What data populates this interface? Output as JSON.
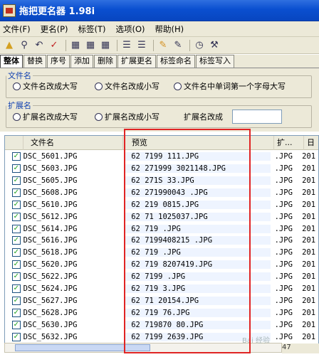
{
  "window": {
    "title": "拖把更名器 1.98i"
  },
  "menu": [
    "文件(F)",
    "更名(P)",
    "标签(T)",
    "选项(O)",
    "帮助(H)"
  ],
  "toolbar_icons": [
    "open-folder-icon",
    "search-icon",
    "undo-icon",
    "check-icon",
    "tag-icon",
    "tag2-icon",
    "tag3-icon",
    "list-icon",
    "list2-icon",
    "edit-icon",
    "edit2-icon",
    "clock-icon",
    "tools-icon"
  ],
  "tabs": [
    "整体",
    "替换",
    "序号",
    "添加",
    "删除",
    "扩展更名",
    "标签命名",
    "标签写入"
  ],
  "filename_group": {
    "legend": "文件名",
    "options": [
      "文件名改成大写",
      "文件名改成小写",
      "文件名中单词第一个字母大写"
    ]
  },
  "ext_group": {
    "legend": "扩展名",
    "options": [
      "扩展名改成大写",
      "扩展名改成小写"
    ],
    "change_label": "扩展名改成",
    "change_value": ""
  },
  "columns": [
    "文件名",
    "预览",
    "扩...",
    "日"
  ],
  "rows": [
    {
      "file": "DSC_5601.JPG",
      "preview": "62   7199    111.JPG",
      "ext": ".JPG",
      "date": "201"
    },
    {
      "file": "DSC_5603.JPG",
      "preview": "62  271999  3021148.JPG",
      "ext": ".JPG",
      "date": "201"
    },
    {
      "file": "DSC_5605.JPG",
      "preview": "62  271S       33.JPG",
      "ext": ".JPG",
      "date": "201"
    },
    {
      "file": "DSC_5608.JPG",
      "preview": "62  271990043      .JPG",
      "ext": ".JPG",
      "date": "201"
    },
    {
      "file": "DSC_5610.JPG",
      "preview": "62  219      0815.JPG",
      "ext": ".JPG",
      "date": "201"
    },
    {
      "file": "DSC_5612.JPG",
      "preview": "62   71     1025037.JPG",
      "ext": ".JPG",
      "date": "201"
    },
    {
      "file": "DSC_5614.JPG",
      "preview": "62   719         .JPG",
      "ext": ".JPG",
      "date": "201"
    },
    {
      "file": "DSC_5616.JPG",
      "preview": "62   7199408215    .JPG",
      "ext": ".JPG",
      "date": "201"
    },
    {
      "file": "DSC_5618.JPG",
      "preview": "62   719         .JPG",
      "ext": ".JPG",
      "date": "201"
    },
    {
      "file": "DSC_5620.JPG",
      "preview": "62   719    8207419.JPG",
      "ext": ".JPG",
      "date": "201"
    },
    {
      "file": "DSC_5622.JPG",
      "preview": "62   7199         .JPG",
      "ext": ".JPG",
      "date": "201"
    },
    {
      "file": "DSC_5624.JPG",
      "preview": "62   719         3.JPG",
      "ext": ".JPG",
      "date": "201"
    },
    {
      "file": "DSC_5627.JPG",
      "preview": "62   71    20154.JPG",
      "ext": ".JPG",
      "date": "201"
    },
    {
      "file": "DSC_5628.JPG",
      "preview": "62   719        76.JPG",
      "ext": ".JPG",
      "date": "201"
    },
    {
      "file": "DSC_5630.JPG",
      "preview": "62   719870      80.JPG",
      "ext": ".JPG",
      "date": "201"
    },
    {
      "file": "DSC_5632.JPG",
      "preview": "62   7199     2639.JPG",
      "ext": ".JPG",
      "date": "201"
    }
  ],
  "status": "47 ",
  "watermark": "Bai 经验"
}
